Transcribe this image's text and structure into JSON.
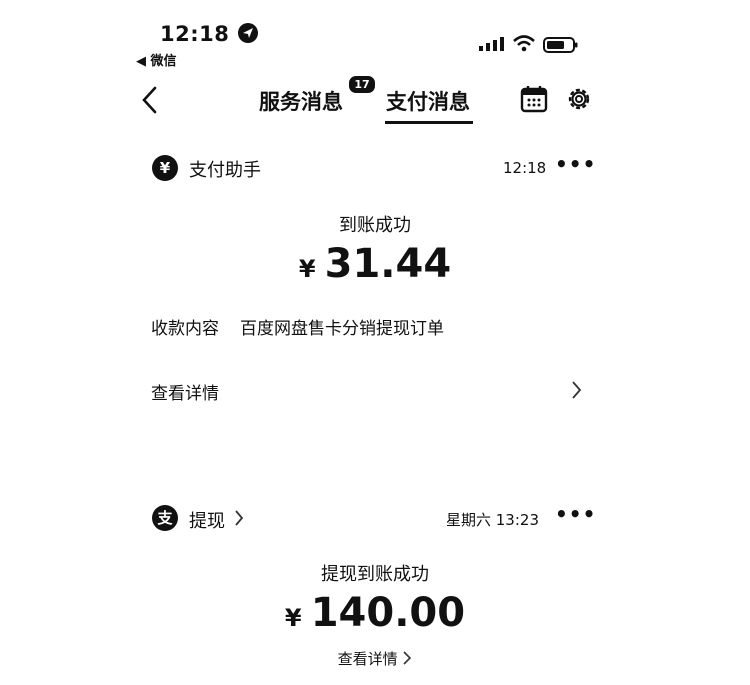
{
  "status_bar": {
    "time": "12:18",
    "back_app": "◀ 微信"
  },
  "nav": {
    "tabs": [
      {
        "label": "服务消息",
        "badge": "17"
      },
      {
        "label": "支付消息"
      }
    ]
  },
  "card1": {
    "sender": "支付助手",
    "time": "12:18",
    "title": "到账成功",
    "currency": "¥",
    "amount": "31.44",
    "field_label": "收款内容",
    "field_value": "百度网盘售卡分销提现订单",
    "detail_link": "查看详情"
  },
  "card2": {
    "sender": "提现",
    "time": "星期六 13:23",
    "title": "提现到账成功",
    "currency": "¥",
    "amount": "140.00",
    "detail_link": "查看详情"
  },
  "colors": {
    "text": "#111111",
    "background": "#ffffff"
  }
}
